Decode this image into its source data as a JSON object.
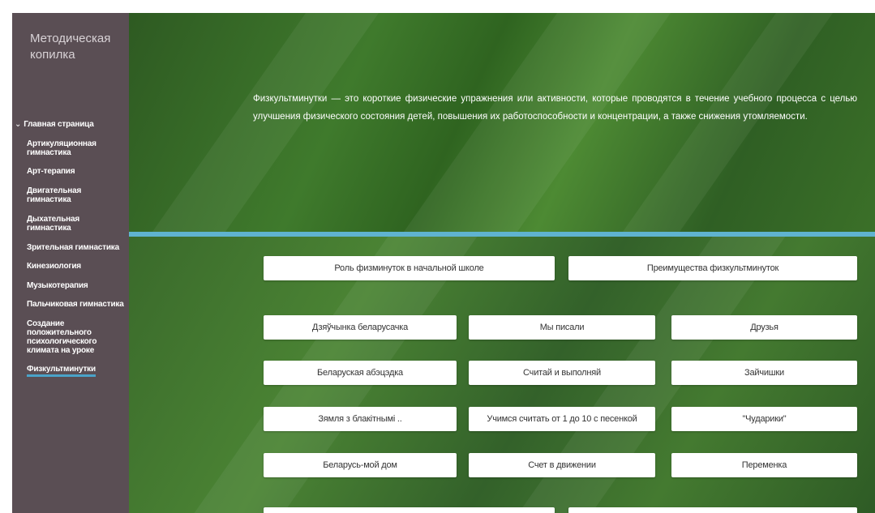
{
  "sidebar": {
    "site_title": "Методическая копилка",
    "items": [
      {
        "label": "Главная страница",
        "chevron": "⌄"
      },
      {
        "label": "Артикуляционная гимнастика"
      },
      {
        "label": "Арт-терапия"
      },
      {
        "label": "Двигательная гимнастика"
      },
      {
        "label": "Дыхательная гимнастика"
      },
      {
        "label": "Зрительная гимнастика"
      },
      {
        "label": "Кинезиология"
      },
      {
        "label": "Музыкотерапия"
      },
      {
        "label": "Пальчиковая гимнастика"
      },
      {
        "label": "Создание положительного психологического климата на уроке"
      },
      {
        "label": "Физкультминутки"
      }
    ]
  },
  "hero": {
    "text": "Физкультминутки — это короткие физические упражнения или активности, которые проводятся в течение учебного процесса с целью улучшения физического состояния детей, повышения их работоспособности и концентрации, а также снижения утомляемости."
  },
  "buttons": {
    "top": [
      "Роль физминуток в начальной школе",
      "Преимущества физкультминуток"
    ],
    "grid": [
      [
        "Дзяўчынка беларусачка",
        "Мы писали",
        "Друзья"
      ],
      [
        "Беларуская абэцэдка",
        "Считай и выполняй",
        "Зайчишки"
      ],
      [
        "Зямля з блакітнымі ..",
        "Учимся считать от 1 до 10 с песенкой",
        "\"Чударики\""
      ],
      [
        "Беларусь-мой дом",
        "Счет в движении",
        "Переменка"
      ]
    ]
  },
  "colors": {
    "sidebar_bg": "#5a4e54",
    "main_green": "#3f7a2c",
    "accent_band": "#5fb3d0",
    "active_underline": "#4aa3c9"
  }
}
